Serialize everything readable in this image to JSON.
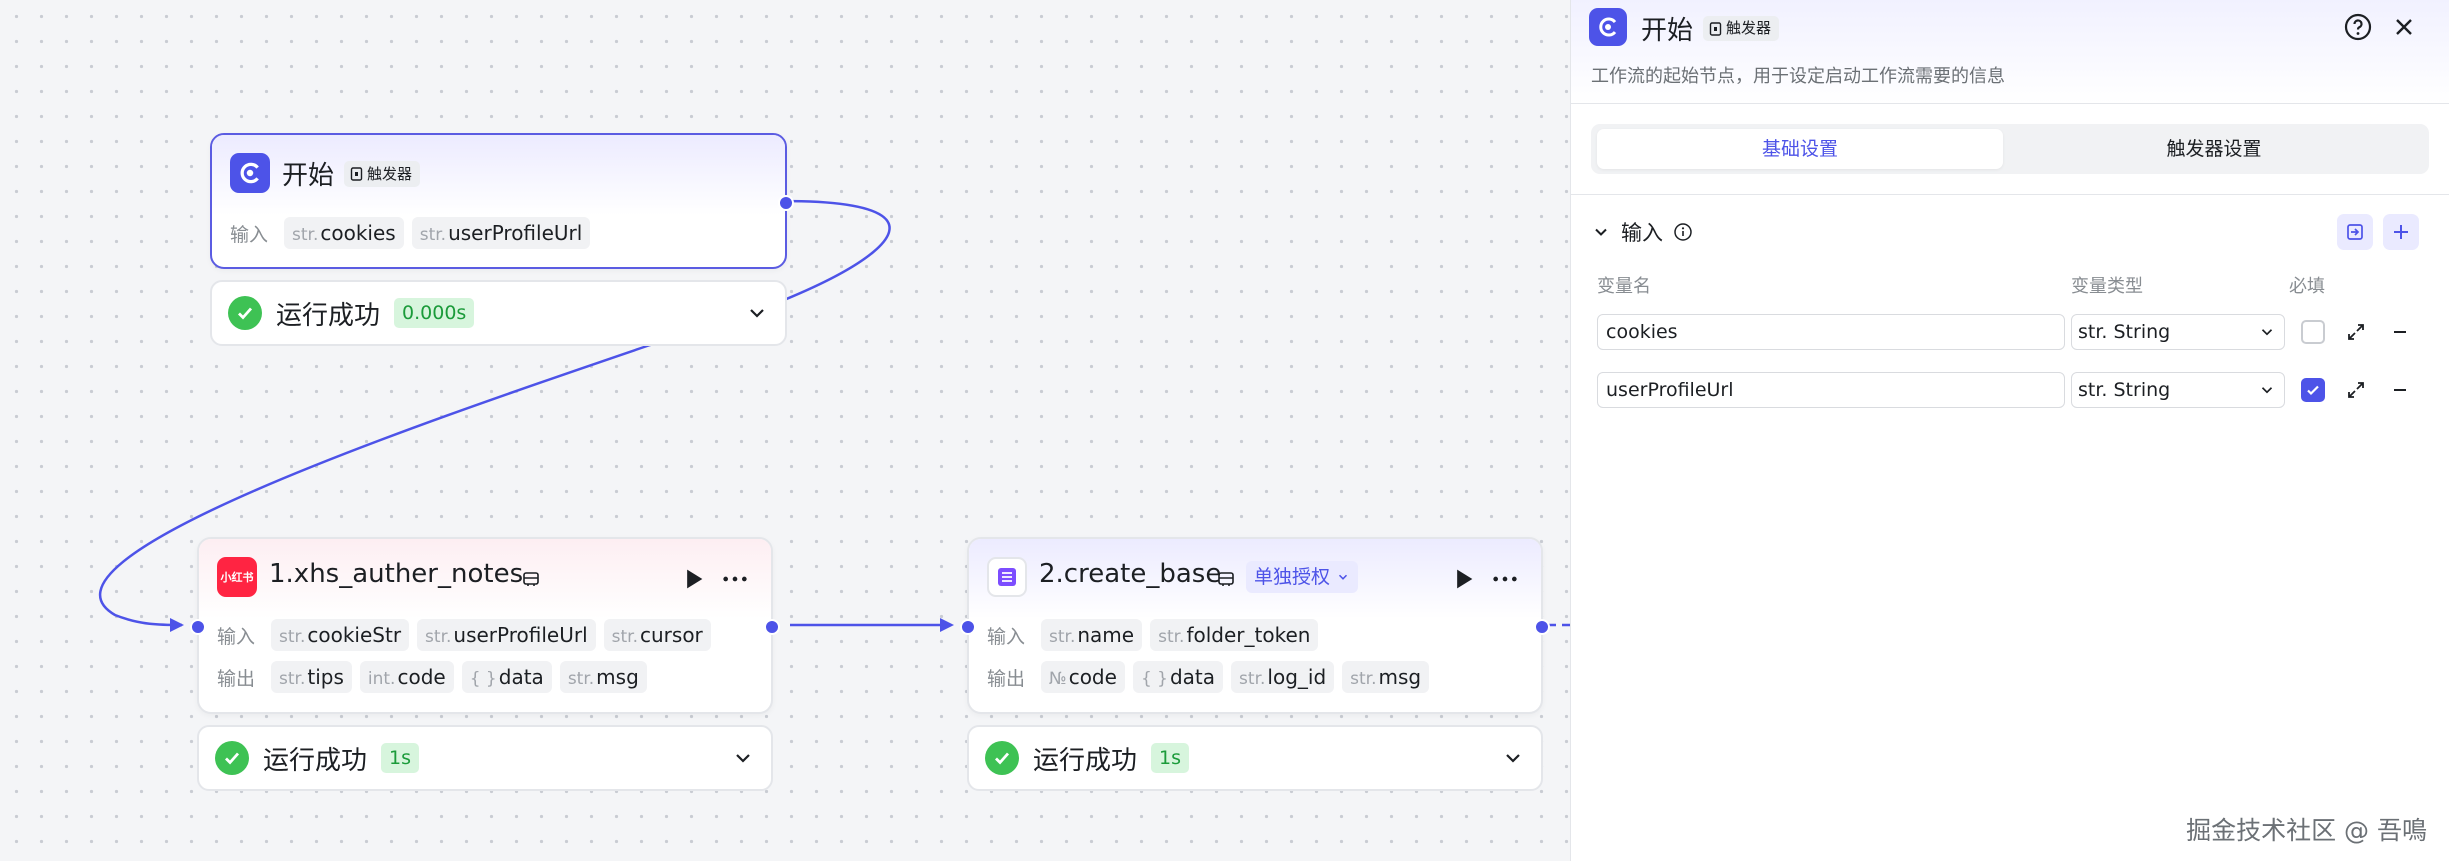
{
  "canvas": {
    "start_node": {
      "title": "开始",
      "trigger_tag": "触发器",
      "io_label": "输入",
      "inputs": [
        {
          "type": "str.",
          "name": "cookies"
        },
        {
          "type": "str.",
          "name": "userProfileUrl"
        }
      ],
      "result": {
        "text": "运行成功",
        "time": "0.000s"
      }
    },
    "node1": {
      "icon_text": "小红书",
      "title": "1.xhs_auther_notes",
      "input_label": "输入",
      "inputs": [
        {
          "type": "str.",
          "name": "cookieStr"
        },
        {
          "type": "str.",
          "name": "userProfileUrl"
        },
        {
          "type": "str.",
          "name": "cursor"
        }
      ],
      "output_label": "输出",
      "outputs": [
        {
          "type": "str.",
          "name": "tips"
        },
        {
          "type": "int.",
          "name": "code"
        },
        {
          "type": "{ }",
          "name": "data"
        },
        {
          "type": "str.",
          "name": "msg"
        }
      ],
      "result": {
        "text": "运行成功",
        "time": "1s"
      }
    },
    "node2": {
      "title": "2.create_base",
      "auth_tag": "单独授权",
      "input_label": "输入",
      "inputs": [
        {
          "type": "str.",
          "name": "name"
        },
        {
          "type": "str.",
          "name": "folder_token"
        }
      ],
      "output_label": "输出",
      "outputs": [
        {
          "type": "№",
          "name": "code"
        },
        {
          "type": "{ }",
          "name": "data"
        },
        {
          "type": "str.",
          "name": "log_id"
        },
        {
          "type": "str.",
          "name": "msg"
        }
      ],
      "result": {
        "text": "运行成功",
        "time": "1s"
      }
    }
  },
  "panel": {
    "title": "开始",
    "trigger_tag": "触发器",
    "description": "工作流的起始节点，用于设定启动工作流需要的信息",
    "tabs": [
      "基础设置",
      "触发器设置"
    ],
    "section_title": "输入",
    "columns": {
      "name": "变量名",
      "type": "变量类型",
      "required": "必填"
    },
    "variables": [
      {
        "name": "cookies",
        "type": "str. String",
        "required": false
      },
      {
        "name": "userProfileUrl",
        "type": "str. String",
        "required": true
      }
    ]
  },
  "watermark": "掘金技术社区 @ 吾鳴",
  "colors": {
    "accent": "#4d53e8",
    "success": "#3ec254",
    "xhs_red": "#ff2442"
  }
}
